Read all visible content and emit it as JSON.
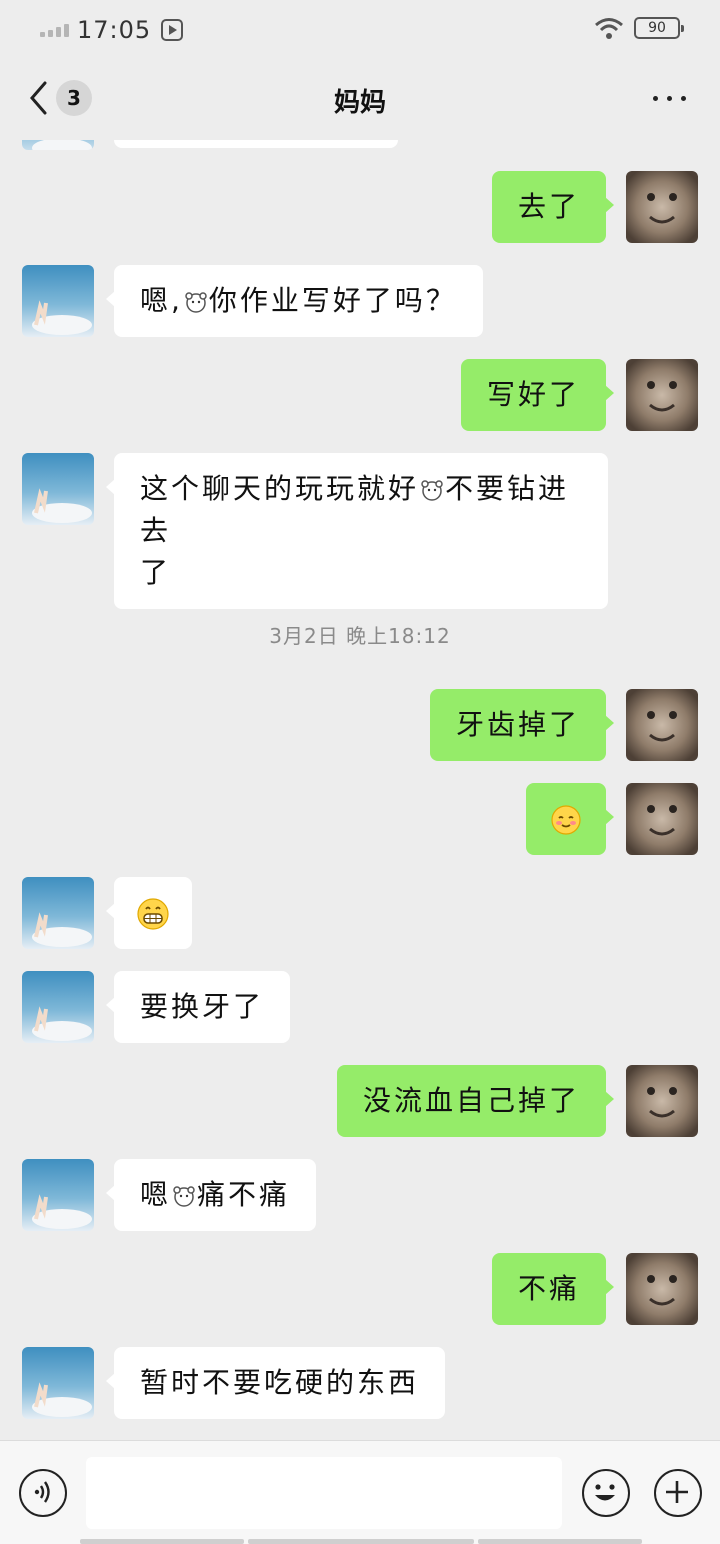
{
  "status_bar": {
    "time": "17:05",
    "battery": "90"
  },
  "header": {
    "unread_count": "3",
    "title": "妈妈"
  },
  "messages": [
    {
      "side": "right",
      "text": "去了"
    },
    {
      "side": "left",
      "text_before": "嗯,",
      "emoji": "bear-emoji",
      "text_after": "你作业写好了吗？"
    },
    {
      "side": "right",
      "text": "写好了"
    },
    {
      "side": "left",
      "text_line1_before": "这个聊天的玩玩就好",
      "emoji": "bear-emoji",
      "text_line1_after": "不要钻进去",
      "text_line2": "了"
    },
    {
      "type": "timestamp",
      "text": "3月2日 晚上18:12"
    },
    {
      "side": "right",
      "text": "牙齿掉了"
    },
    {
      "side": "right",
      "emoji": "blush-emoji"
    },
    {
      "side": "left",
      "emoji": "grin-emoji"
    },
    {
      "side": "left",
      "text": "要换牙了"
    },
    {
      "side": "right",
      "text": "没流血自己掉了"
    },
    {
      "side": "left",
      "text_before": "嗯",
      "emoji": "bear-emoji",
      "text_after": "痛不痛"
    },
    {
      "side": "right",
      "text": "不痛"
    },
    {
      "side": "left",
      "text": "暂时不要吃硬的东西"
    }
  ],
  "icons": {
    "back": "chevron-left-icon",
    "more": "more-dots-icon",
    "voice": "voice-icon",
    "emoji": "emoji-icon",
    "plus": "plus-icon"
  },
  "colors": {
    "background": "#ededed",
    "sent_bubble": "#95ec69",
    "received_bubble": "#ffffff",
    "timestamp": "#8a8a8a"
  },
  "input": {
    "value": ""
  }
}
